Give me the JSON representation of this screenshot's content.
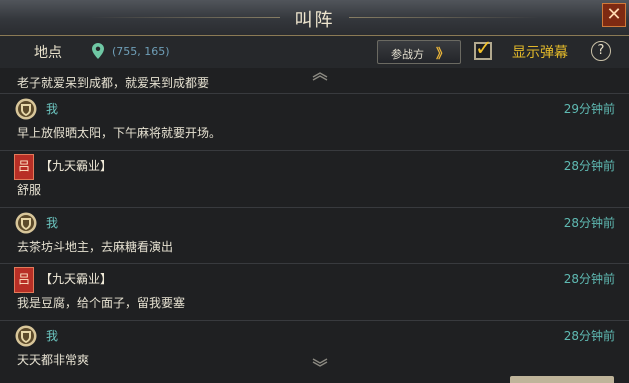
{
  "window": {
    "title": "叫阵",
    "close_glyph": "✕"
  },
  "header": {
    "location_label": "地点",
    "coords": "(755, 165)",
    "join_button": "参战方",
    "join_arrow": "》",
    "show_barrage_checked": true,
    "show_barrage_label": "显示弹幕",
    "help": "?"
  },
  "list": {
    "top_snippet": "老子就爱呆到成都，就爱呆到成都要",
    "messages": [
      {
        "sender": "我",
        "badge": "",
        "type": "self",
        "text": "早上放假晒太阳，下午麻将就要开场。",
        "time": "29分钟前"
      },
      {
        "sender": "【九天霸业】",
        "badge": "吕",
        "type": "guild",
        "text": "舒服",
        "time": "28分钟前"
      },
      {
        "sender": "我",
        "badge": "",
        "type": "self",
        "text": "去茶坊斗地主，去麻糖看演出",
        "time": "28分钟前"
      },
      {
        "sender": "【九天霸业】",
        "badge": "吕",
        "type": "guild",
        "text": "我是豆腐，给个面子，留我要塞",
        "time": "28分钟前"
      },
      {
        "sender": "我",
        "badge": "",
        "type": "self",
        "text": "天天都非常爽",
        "time": "28分钟前"
      }
    ]
  },
  "colors": {
    "self_name": "#6cc6c1",
    "time": "#5fbab3",
    "barrage_label": "#e0b72a",
    "guild_badge": "#b82f26"
  },
  "icons": {
    "location": "map-pin-icon",
    "self_avatar": "shield-avatar-icon",
    "guild_badge": "faction-badge-icon"
  }
}
